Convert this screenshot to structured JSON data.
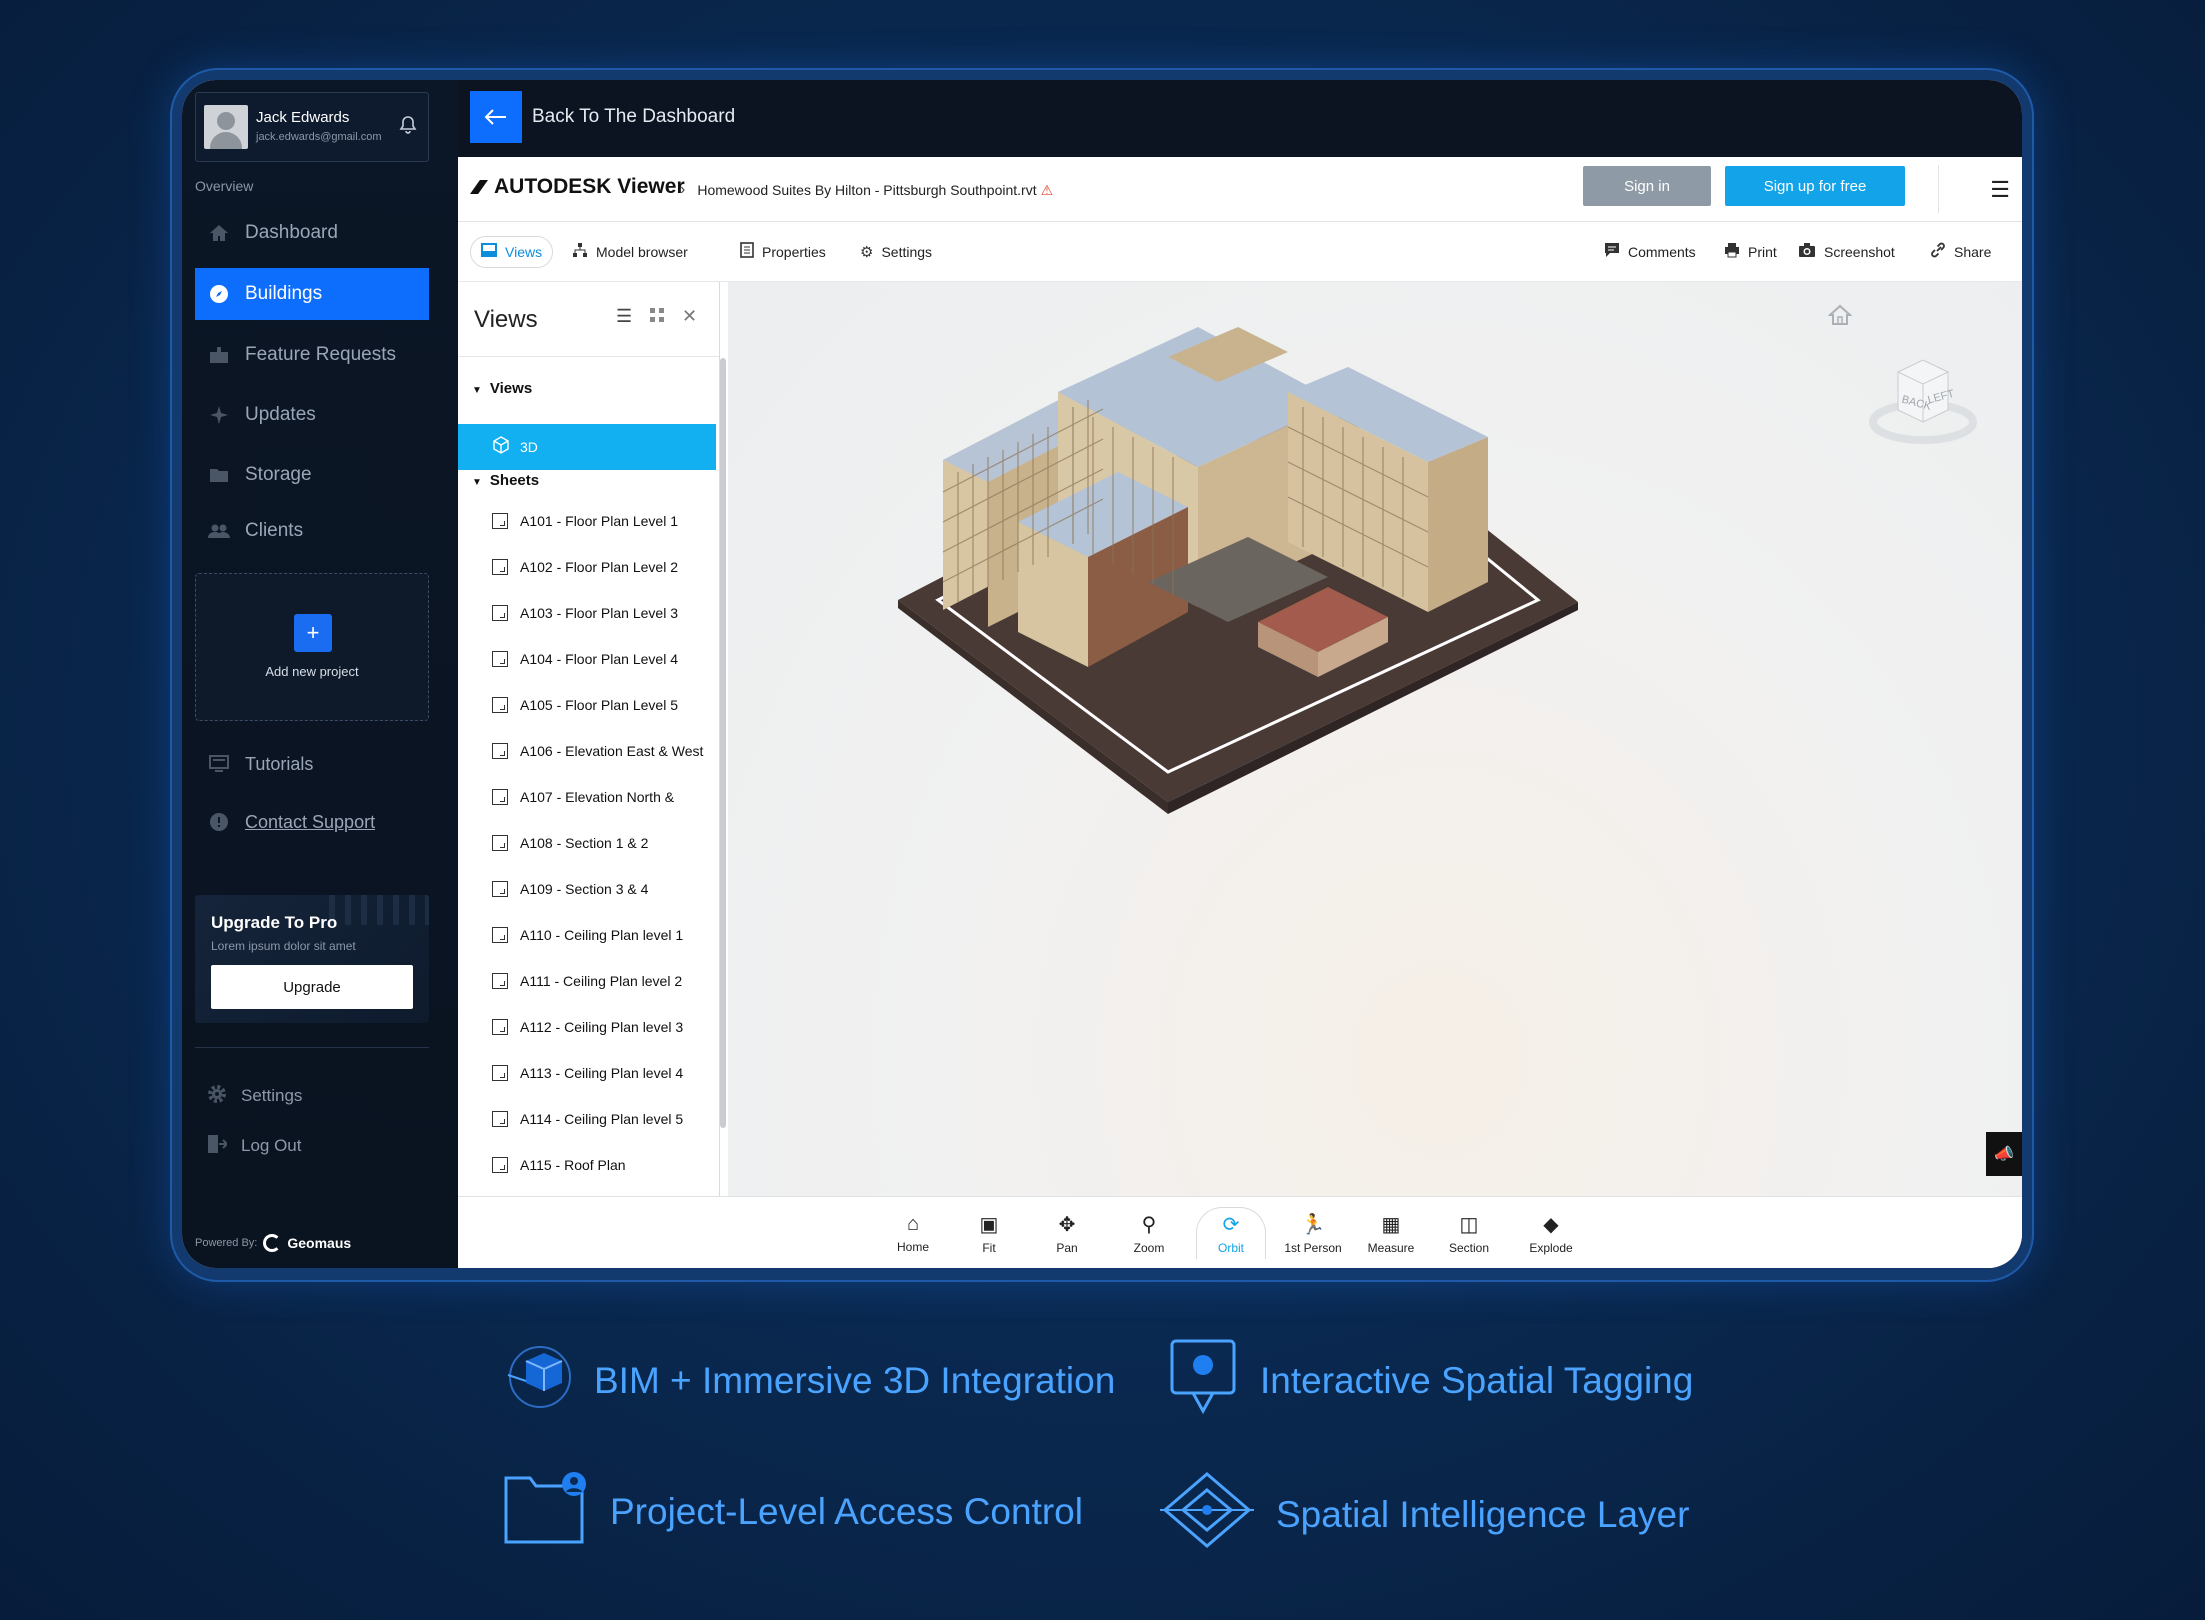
{
  "user": {
    "name": "Jack Edwards",
    "email": "jack.edwards@gmail.com"
  },
  "sidebar": {
    "section_label": "Overview",
    "items": [
      {
        "label": "Dashboard",
        "icon": "home-icon"
      },
      {
        "label": "Buildings",
        "icon": "compass-icon"
      },
      {
        "label": "Feature Requests",
        "icon": "inbox-icon"
      },
      {
        "label": "Updates",
        "icon": "sparkle-icon"
      },
      {
        "label": "Storage",
        "icon": "folder-icon"
      },
      {
        "label": "Clients",
        "icon": "users-icon"
      }
    ],
    "active": "Buildings",
    "add_project": {
      "symbol": "+",
      "label": "Add new project"
    },
    "tutorials": "Tutorials",
    "contact_support": "Contact Support",
    "upgrade": {
      "title": "Upgrade To Pro",
      "subtitle": "Lorem ipsum dolor sit amet",
      "button": "Upgrade"
    },
    "settings": "Settings",
    "logout": "Log Out",
    "powered_by": "Powered By:",
    "brand": "Geomaus"
  },
  "topbar": {
    "back_label": "Back To The Dashboard"
  },
  "autodesk": {
    "logo_text": "AUTODESK Viewer",
    "file_name": "Homewood Suites By Hilton - Pittsburgh Southpoint.rvt",
    "sign_in": "Sign in",
    "sign_up": "Sign up for free"
  },
  "toolbar": {
    "left": [
      "Views",
      "Model browser",
      "Properties",
      "Settings"
    ],
    "right": [
      "Comments",
      "Print",
      "Screenshot",
      "Share"
    ],
    "active": "Views"
  },
  "views_panel": {
    "title": "Views",
    "views_section": "Views",
    "view_item": "3D",
    "sheets_section": "Sheets",
    "sheets": [
      "A101 - Floor Plan Level 1",
      "A102 - Floor Plan Level 2",
      "A103 - Floor Plan Level 3",
      "A104 - Floor Plan Level 4",
      "A105 - Floor Plan Level 5",
      "A106 - Elevation East & West",
      "A107 - Elevation North &",
      "A108 - Section 1 & 2",
      "A109 - Section 3 & 4",
      "A110 - Ceiling Plan level 1",
      "A111 - Ceiling Plan level 2",
      "A112 - Ceiling Plan level 3",
      "A113 - Ceiling Plan level 4",
      "A114 - Ceiling Plan level 5",
      "A115 - Roof Plan"
    ]
  },
  "viewcube": {
    "faces": [
      "BACK",
      "LEFT"
    ]
  },
  "bottom_tools": [
    "Home",
    "Fit",
    "Pan",
    "Zoom",
    "Orbit",
    "1st Person",
    "Measure",
    "Section",
    "Explode"
  ],
  "bottom_active": "Orbit",
  "features": [
    "BIM + Immersive 3D Integration",
    "Interactive Spatial Tagging",
    "Project-Level Access Control",
    "Spatial Intelligence Layer"
  ],
  "colors": {
    "accent": "#0d6efd",
    "autodesk_blue": "#12a3e8",
    "feature_text": "#4aa3ff",
    "background": "#0a2a52"
  }
}
